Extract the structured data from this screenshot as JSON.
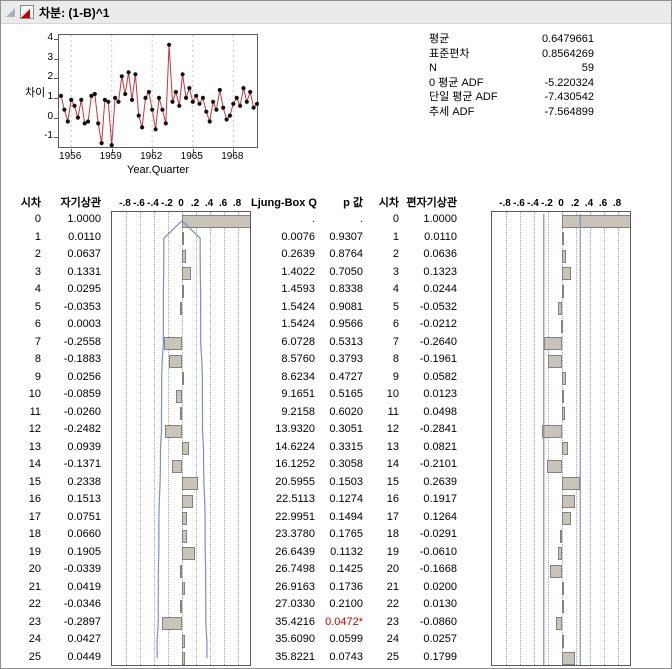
{
  "window": {
    "title": "차분: (1-B)^1"
  },
  "timeseries": {
    "ylabel": "차이",
    "xlabel": "Year.Quarter",
    "yticks": [
      4,
      3,
      2,
      1,
      0,
      -1
    ],
    "xticks": [
      1956,
      1959,
      1962,
      1965,
      1968
    ],
    "ylim": [
      -1.6,
      4.2
    ],
    "xlim": [
      1955.1,
      1969.9
    ],
    "x_start": 1955.25,
    "x_step": 0.25,
    "line_color": "#c93538",
    "marker_color": "#111111",
    "values": [
      1.1,
      0.4,
      -0.2,
      0.9,
      0.6,
      0.0,
      0.9,
      -0.3,
      -0.2,
      1.1,
      1.2,
      -0.3,
      -1.3,
      0.9,
      0.8,
      -1.4,
      1.0,
      0.8,
      2.1,
      1.2,
      2.3,
      0.9,
      2.2,
      0.1,
      -0.5,
      1.0,
      1.3,
      0.4,
      -0.6,
      1.0,
      0.4,
      -0.3,
      3.7,
      0.8,
      1.3,
      0.6,
      2.2,
      1.0,
      1.5,
      0.8,
      1.1,
      0.7,
      1.0,
      0.3,
      -0.2,
      0.8,
      0.4,
      1.4,
      0.5,
      -0.1,
      0.1,
      0.7,
      1.0,
      0.6,
      1.5,
      0.8,
      1.3,
      0.5,
      0.7
    ]
  },
  "stats": {
    "rows": [
      {
        "label": "평균",
        "value": "0.6479661"
      },
      {
        "label": "표준편차",
        "value": "0.8564269"
      },
      {
        "label": "N",
        "value": "59"
      },
      {
        "label": "0 평균 ADF",
        "value": "-5.220324"
      },
      {
        "label": "단일 평균 ADF",
        "value": "-7.430542"
      },
      {
        "label": "추세 ADF",
        "value": "-7.564899"
      }
    ]
  },
  "table": {
    "headers": {
      "lag": "시차",
      "acf": "자기상관",
      "q": "Ljung-Box Q",
      "p": "p 값",
      "lag2": "시차",
      "pacf": "편자기상관"
    },
    "axis_ticks": [
      "-.8",
      "-.6",
      "-.4",
      "-.2",
      "0",
      ".2",
      ".4",
      ".6",
      ".8"
    ],
    "axis_values": [
      -0.8,
      -0.6,
      -0.4,
      -0.2,
      0,
      0.2,
      0.4,
      0.6,
      0.8
    ],
    "n": 59,
    "bar_color": "#c9c4b9",
    "bar_border": "#85827b",
    "band_color": "#7590cd",
    "sig_color": "#cc0000",
    "rows": [
      {
        "lag": "0",
        "acf": "1.0000",
        "q": ".",
        "p": ".",
        "sig": false,
        "lag2": "0",
        "pacf": "1.0000"
      },
      {
        "lag": "1",
        "acf": "0.0110",
        "q": "0.0076",
        "p": "0.9307",
        "sig": false,
        "lag2": "1",
        "pacf": "0.0110"
      },
      {
        "lag": "2",
        "acf": "0.0637",
        "q": "0.2639",
        "p": "0.8764",
        "sig": false,
        "lag2": "2",
        "pacf": "0.0636"
      },
      {
        "lag": "3",
        "acf": "0.1331",
        "q": "1.4022",
        "p": "0.7050",
        "sig": false,
        "lag2": "3",
        "pacf": "0.1323"
      },
      {
        "lag": "4",
        "acf": "0.0295",
        "q": "1.4593",
        "p": "0.8338",
        "sig": false,
        "lag2": "4",
        "pacf": "0.0244"
      },
      {
        "lag": "5",
        "acf": "-0.0353",
        "q": "1.5424",
        "p": "0.9081",
        "sig": false,
        "lag2": "5",
        "pacf": "-0.0532"
      },
      {
        "lag": "6",
        "acf": "0.0003",
        "q": "1.5424",
        "p": "0.9566",
        "sig": false,
        "lag2": "6",
        "pacf": "-0.0212"
      },
      {
        "lag": "7",
        "acf": "-0.2558",
        "q": "6.0728",
        "p": "0.5313",
        "sig": false,
        "lag2": "7",
        "pacf": "-0.2640"
      },
      {
        "lag": "8",
        "acf": "-0.1883",
        "q": "8.5760",
        "p": "0.3793",
        "sig": false,
        "lag2": "8",
        "pacf": "-0.1961"
      },
      {
        "lag": "9",
        "acf": "0.0256",
        "q": "8.6234",
        "p": "0.4727",
        "sig": false,
        "lag2": "9",
        "pacf": "0.0582"
      },
      {
        "lag": "10",
        "acf": "-0.0859",
        "q": "9.1651",
        "p": "0.5165",
        "sig": false,
        "lag2": "10",
        "pacf": "0.0123"
      },
      {
        "lag": "11",
        "acf": "-0.0260",
        "q": "9.2158",
        "p": "0.6020",
        "sig": false,
        "lag2": "11",
        "pacf": "0.0498"
      },
      {
        "lag": "12",
        "acf": "-0.2482",
        "q": "13.9320",
        "p": "0.3051",
        "sig": false,
        "lag2": "12",
        "pacf": "-0.2841"
      },
      {
        "lag": "13",
        "acf": "0.0939",
        "q": "14.6224",
        "p": "0.3315",
        "sig": false,
        "lag2": "13",
        "pacf": "0.0821"
      },
      {
        "lag": "14",
        "acf": "-0.1371",
        "q": "16.1252",
        "p": "0.3058",
        "sig": false,
        "lag2": "14",
        "pacf": "-0.2101"
      },
      {
        "lag": "15",
        "acf": "0.2338",
        "q": "20.5955",
        "p": "0.1503",
        "sig": false,
        "lag2": "15",
        "pacf": "0.2639"
      },
      {
        "lag": "16",
        "acf": "0.1513",
        "q": "22.5113",
        "p": "0.1274",
        "sig": false,
        "lag2": "16",
        "pacf": "0.1917"
      },
      {
        "lag": "17",
        "acf": "0.0751",
        "q": "22.9951",
        "p": "0.1494",
        "sig": false,
        "lag2": "17",
        "pacf": "0.1264"
      },
      {
        "lag": "18",
        "acf": "0.0660",
        "q": "23.3780",
        "p": "0.1765",
        "sig": false,
        "lag2": "18",
        "pacf": "-0.0291"
      },
      {
        "lag": "19",
        "acf": "0.1905",
        "q": "26.6439",
        "p": "0.1132",
        "sig": false,
        "lag2": "19",
        "pacf": "-0.0610"
      },
      {
        "lag": "20",
        "acf": "-0.0339",
        "q": "26.7498",
        "p": "0.1425",
        "sig": false,
        "lag2": "20",
        "pacf": "-0.1668"
      },
      {
        "lag": "21",
        "acf": "0.0419",
        "q": "26.9163",
        "p": "0.1736",
        "sig": false,
        "lag2": "21",
        "pacf": "0.0200"
      },
      {
        "lag": "22",
        "acf": "-0.0346",
        "q": "27.0330",
        "p": "0.2100",
        "sig": false,
        "lag2": "22",
        "pacf": "0.0130"
      },
      {
        "lag": "23",
        "acf": "-0.2897",
        "q": "35.4216",
        "p": "0.0472*",
        "sig": true,
        "lag2": "23",
        "pacf": "-0.0860"
      },
      {
        "lag": "24",
        "acf": "0.0427",
        "q": "35.6090",
        "p": "0.0599",
        "sig": false,
        "lag2": "24",
        "pacf": "0.0257"
      },
      {
        "lag": "25",
        "acf": "0.0449",
        "q": "35.8221",
        "p": "0.0743",
        "sig": false,
        "lag2": "25",
        "pacf": "0.1799"
      }
    ]
  }
}
